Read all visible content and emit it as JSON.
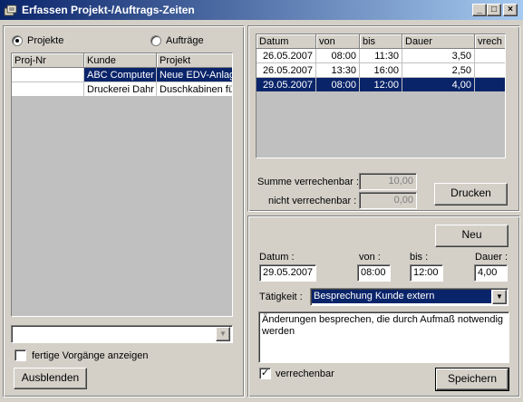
{
  "window": {
    "title": "Erfassen Projekt-/Auftrags-Zeiten"
  },
  "left": {
    "radio_projekte": "Projekte",
    "radio_auftraege": "Aufträge",
    "columns": [
      "Proj-Nr",
      "Kunde",
      "Projekt"
    ],
    "rows": [
      {
        "projnr": "",
        "kunde": "ABC Computer I",
        "projekt": "Neue EDV-Anlag"
      },
      {
        "projnr": "",
        "kunde": "Druckerei Dahr",
        "projekt": "Duschkabinen fü"
      }
    ],
    "filter_value": "",
    "checkbox_fertige": "fertige Vorgänge anzeigen",
    "button_ausblenden": "Ausblenden"
  },
  "times": {
    "columns": [
      "Datum",
      "von",
      "bis",
      "Dauer",
      "vrech"
    ],
    "rows": [
      {
        "datum": "26.05.2007",
        "von": "08:00",
        "bis": "11:30",
        "dauer": "3,50",
        "vrech": ""
      },
      {
        "datum": "26.05.2007",
        "von": "13:30",
        "bis": "16:00",
        "dauer": "2,50",
        "vrech": ""
      },
      {
        "datum": "29.05.2007",
        "von": "08:00",
        "bis": "12:00",
        "dauer": "4,00",
        "vrech": ""
      }
    ],
    "summe_label": "Summe verrechenbar :",
    "summe_value": "10,00",
    "nicht_label": "nicht verrechenbar :",
    "nicht_value": "0,00",
    "button_drucken": "Drucken"
  },
  "entry": {
    "button_neu": "Neu",
    "datum_label": "Datum :",
    "datum_value": "29.05.2007",
    "von_label": "von :",
    "von_value": "08:00",
    "bis_label": "bis :",
    "bis_value": "12:00",
    "dauer_label": "Dauer :",
    "dauer_value": "4,00",
    "taetigkeit_label": "Tätigkeit :",
    "taetigkeit_value": "Besprechung Kunde extern",
    "notes": "Änderungen besprechen, die durch Aufmaß notwendig werden",
    "checkbox_verrechenbar": "verrechenbar",
    "button_speichern": "Speichern"
  },
  "colors": {
    "title_start": "#0a246a",
    "title_end": "#a6caf0",
    "selection": "#0a246a",
    "face": "#d4d0c8"
  }
}
